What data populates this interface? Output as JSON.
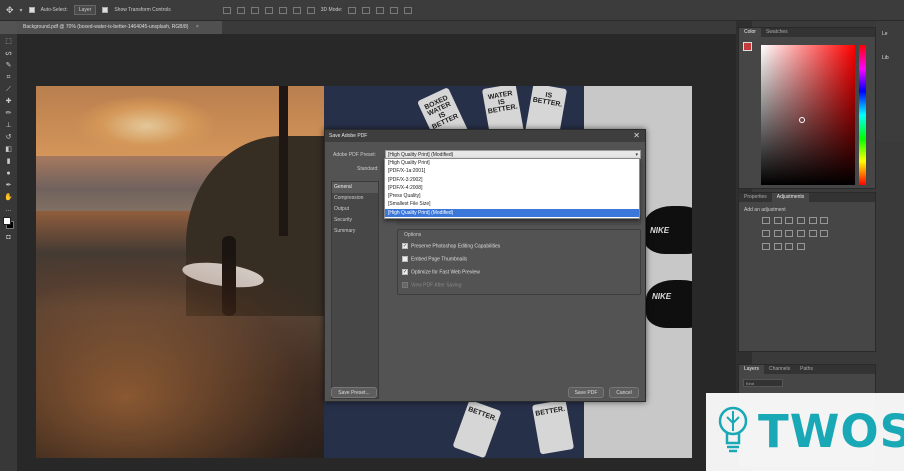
{
  "options_bar": {
    "auto_select_label": "Auto-Select:",
    "layer_select_value": "Layer",
    "show_transform_label": "Show Transform Controls",
    "mode_3d_label": "3D Mode:"
  },
  "document_tab": {
    "title": "Background.pdf @ 70% (boxed-water-is-better-1464045-unsplash, RGB/8)",
    "close": "×"
  },
  "dialog": {
    "title": "Save Adobe PDF",
    "close": "✕",
    "preset_label": "Adobe PDF Preset:",
    "preset_value": "[High Quality Print] (Modified)",
    "standard_label": "Standard:",
    "nav_items": [
      "General",
      "Compression",
      "Output",
      "Security",
      "Summary"
    ],
    "options_legend": "Options",
    "options": [
      {
        "label": "Preserve Photoshop Editing Capabilities",
        "checked": true,
        "disabled": false
      },
      {
        "label": "Embed Page Thumbnails",
        "checked": false,
        "disabled": false
      },
      {
        "label": "Optimize for Fast Web Preview",
        "checked": true,
        "disabled": false
      },
      {
        "label": "View PDF After Saving",
        "checked": false,
        "disabled": true
      }
    ],
    "save_preset_label": "Save Preset...",
    "save_pdf_label": "Save PDF",
    "cancel_label": "Cancel"
  },
  "preset_dropdown": {
    "options": [
      "[High Quality Print]",
      "[PDF/X-1a:2001]",
      "[PDF/X-3:2002]",
      "[PDF/X-4:2008]",
      "[Press Quality]",
      "[Smallest File Size]",
      "[High Quality Print] (Modified)"
    ],
    "highlighted_index": 6
  },
  "color_panel": {
    "tabs": [
      "Color",
      "Swatches"
    ],
    "foreground_color": "#c53b3b"
  },
  "adjustments_panel": {
    "tabs": [
      "Properties",
      "Adjustments"
    ],
    "hint": "Add an adjustment"
  },
  "layers_panel": {
    "tabs": [
      "Layers",
      "Channels",
      "Paths"
    ],
    "search_placeholder": "Kind"
  },
  "right_collapsed": {
    "labels": [
      "Le",
      "Lib"
    ]
  },
  "photo": {
    "cartons": [
      "BOXED\nWATER\nIS\nBETTER",
      "WATER\nIS\nBETTER.",
      "IS\nBETTER.",
      "BETTER."
    ],
    "shoe_brand": "NIKE"
  },
  "watermark": {
    "text": "TWOS"
  }
}
